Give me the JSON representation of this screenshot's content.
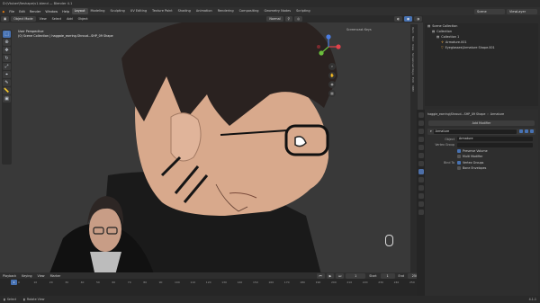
{
  "window": {
    "title": "D:\\Vtuber\\Reshape\\v1.blend — Blender 4.1"
  },
  "menubar": {
    "menus": [
      "File",
      "Edit",
      "Render",
      "Window",
      "Help"
    ],
    "workspaces": [
      "Layout",
      "Modeling",
      "Sculpting",
      "UV Editing",
      "Texture Paint",
      "Shading",
      "Animation",
      "Rendering",
      "Compositing",
      "Geometry Nodes",
      "Scripting"
    ],
    "active_workspace": "Layout",
    "scene": "Scene",
    "view_layer": "ViewLayer"
  },
  "header": {
    "mode": "Object Mode",
    "menus": [
      "View",
      "Select",
      "Add",
      "Object"
    ],
    "orientation": "Normal"
  },
  "viewport": {
    "view_name": "User Perspective",
    "collection_info": "(0) Scene Collection | haggaie_earring.Shroud...SHP_09 Shape",
    "screencast_label": "Screencast Keys",
    "tools": [
      "select",
      "cursor",
      "move",
      "rotate",
      "scale",
      "transform",
      "annotate",
      "measure",
      "add"
    ]
  },
  "side_tabs": [
    "Item",
    "Tool",
    "View",
    "Screencast Keys",
    "Edit",
    "VRM"
  ],
  "timeline": {
    "menus": [
      "Playback",
      "Keying",
      "View",
      "Marker"
    ],
    "current_frame": "1",
    "start_label": "Start",
    "start": "1",
    "end_label": "End",
    "end": "250",
    "ticks": [
      "0",
      "10",
      "20",
      "30",
      "40",
      "50",
      "60",
      "70",
      "80",
      "90",
      "100",
      "110",
      "120",
      "130",
      "140",
      "150",
      "160",
      "170",
      "180",
      "190",
      "200",
      "210",
      "220",
      "230",
      "240",
      "250"
    ]
  },
  "statusbar": {
    "left": "Select",
    "middle": "Rotate View",
    "version": "4.1.1"
  },
  "outliner": {
    "rows": [
      {
        "label": "Scene Collection",
        "indent": 0,
        "selected": false
      },
      {
        "label": "Collection",
        "indent": 1,
        "selected": false
      },
      {
        "label": "Collection 1",
        "indent": 2,
        "selected": false
      },
      {
        "label": "Armature.001",
        "indent": 3,
        "selected": false
      },
      {
        "label": "Eyeglasses\\Armature Shape.001",
        "indent": 3,
        "selected": false
      }
    ]
  },
  "properties": {
    "object_path": "haggie_earring\\Shroud...SHP_09 Shape",
    "context": "Armature",
    "add_modifier": "Add Modifier",
    "modifier_name": "Armature",
    "object_label": "Object",
    "object_value": "Armature",
    "vertex_group_label": "Vertex Group",
    "preserve_volume": "Preserve Volume",
    "multi_modifier": "Multi Modifier",
    "bind_to_label": "Bind To",
    "vertex_groups": "Vertex Groups",
    "bone_envelopes": "Bone Envelopes"
  },
  "colors": {
    "accent": "#4772b3",
    "skin": "#d8a98c",
    "hair": "#2a2220",
    "bg": "#393939"
  }
}
